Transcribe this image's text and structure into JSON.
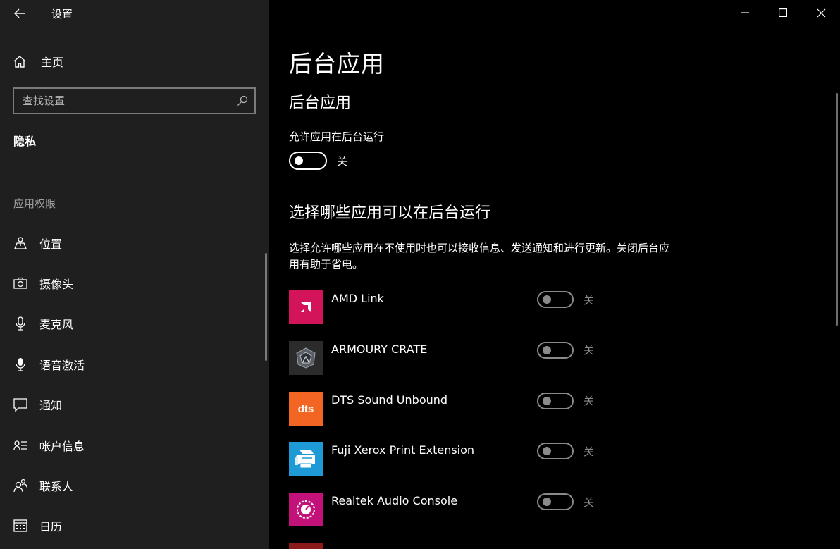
{
  "window": {
    "title": "设置"
  },
  "sidebar": {
    "home_label": "主页",
    "search_placeholder": "查找设置",
    "section_title": "隐私",
    "group_title": "应用权限",
    "items": [
      {
        "label": "位置",
        "icon": "location-icon"
      },
      {
        "label": "摄像头",
        "icon": "camera-icon"
      },
      {
        "label": "麦克风",
        "icon": "microphone-icon"
      },
      {
        "label": "语音激活",
        "icon": "voice-activation-icon"
      },
      {
        "label": "通知",
        "icon": "notification-icon"
      },
      {
        "label": "帐户信息",
        "icon": "account-info-icon"
      },
      {
        "label": "联系人",
        "icon": "contacts-icon"
      },
      {
        "label": "日历",
        "icon": "calendar-icon"
      }
    ]
  },
  "main": {
    "page_title": "后台应用",
    "section1_title": "后台应用",
    "allow_label": "允许应用在后台运行",
    "master_toggle_state": "关",
    "section2_title": "选择哪些应用可以在后台运行",
    "description": "选择允许哪些应用在不使用时也可以接收信息、发送通知和进行更新。关闭后台应用有助于省电。",
    "apps": [
      {
        "name": "AMD Link",
        "state": "关",
        "tile_color": "#d4145a"
      },
      {
        "name": "ARMOURY CRATE",
        "state": "关",
        "tile_color": "#2b2b2b"
      },
      {
        "name": "DTS Sound Unbound",
        "state": "关",
        "tile_color": "#f26522"
      },
      {
        "name": "Fuji Xerox Print Extension",
        "state": "关",
        "tile_color": "#1e9bd7"
      },
      {
        "name": "Realtek Audio Console",
        "state": "关",
        "tile_color": "#c2127a"
      }
    ]
  }
}
